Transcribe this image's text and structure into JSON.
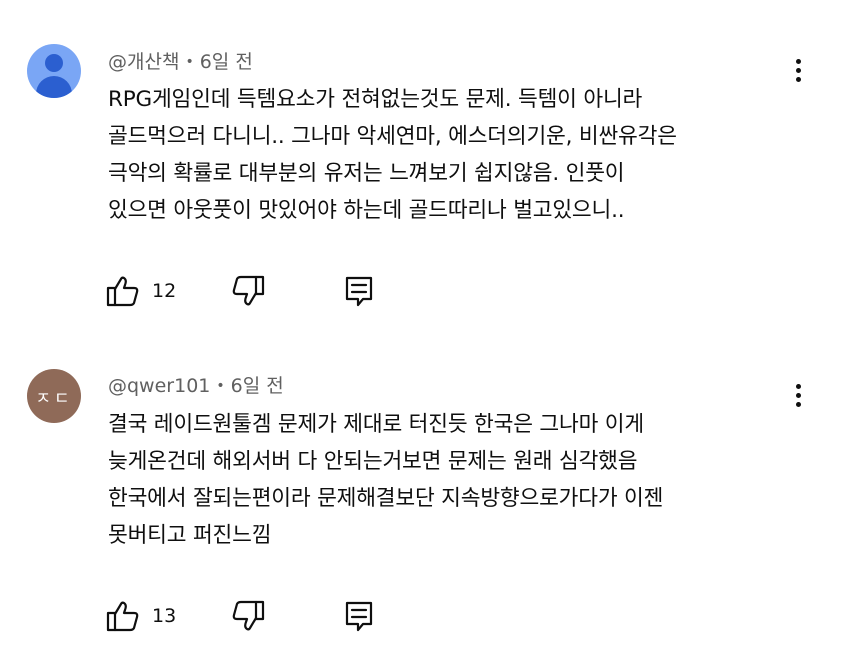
{
  "comments": [
    {
      "author": "@개산책",
      "time": "6일 전",
      "avatar_type": "default-person-icon",
      "avatar_initials": "",
      "lines": [
        "RPG게임인데 득템요소가 전혀없는것도 문제. 득템이 아니라",
        "골드먹으러 다니니.. 그나마 악세연마, 에스더의기운, 비싼유각은",
        "극악의 확률로 대부분의 유저는 느껴보기 쉽지않음. 인풋이",
        "있으면 아웃풋이 맛있어야 하는데 골드따리나 벌고있으니.."
      ],
      "like_count": "12"
    },
    {
      "author": "@qwer101",
      "time": "6일 전",
      "avatar_type": "initials",
      "avatar_initials": "ㅈㄷ",
      "lines": [
        "결국 레이드원툴겜 문제가 제대로 터진듯 한국은 그나마 이게",
        "늦게온건데 해외서버 다 안되는거보면 문제는 원래 심각했음",
        "한국에서 잘되는편이라 문제해결보단 지속방향으로가다가 이젠",
        "못버티고 퍼진느낌"
      ],
      "like_count": "13"
    }
  ],
  "separator": "•",
  "colors": {
    "text_primary": "#0f0f0f",
    "text_secondary": "#606060",
    "avatar_default_bg": "#7aa6f5",
    "avatar_default_fg": "#2b5fd0",
    "avatar_initials_bg": "#8f6a58"
  }
}
